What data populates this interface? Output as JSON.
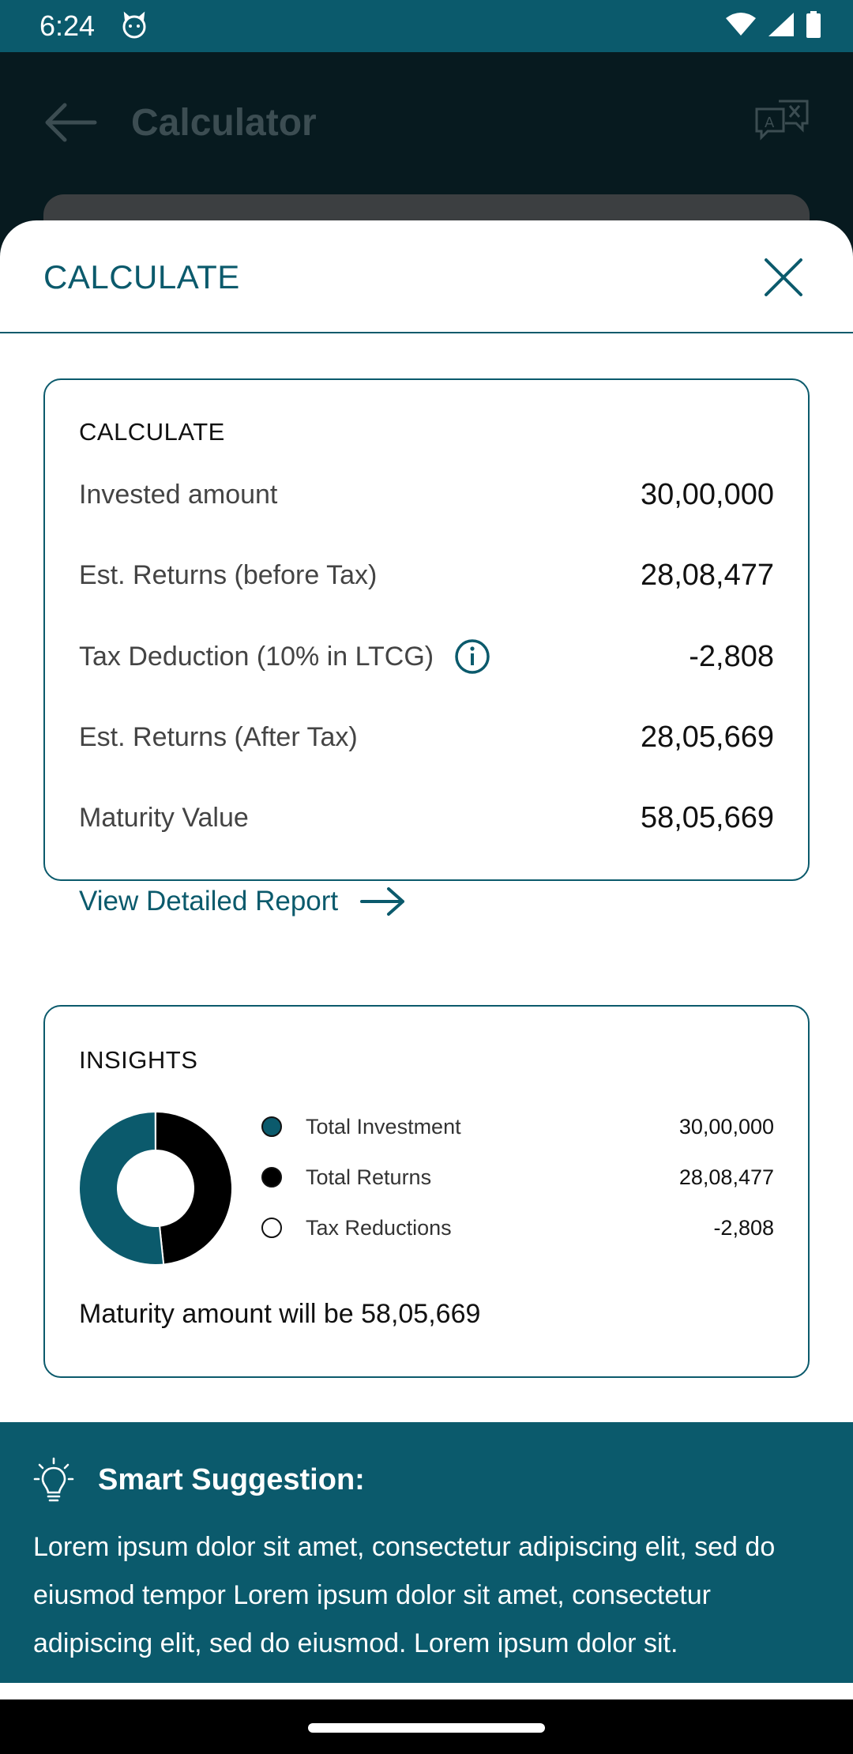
{
  "status_bar": {
    "time": "6:24",
    "icons": [
      "cat-icon",
      "wifi-icon",
      "signal-icon",
      "battery-icon"
    ]
  },
  "app_bar": {
    "title": "Calculator",
    "back_icon": "arrow-left-icon",
    "action_icon": "translate-icon"
  },
  "sheet": {
    "title": "CALCULATE",
    "close_icon": "close-icon"
  },
  "calculate_card": {
    "heading": "CALCULATE",
    "rows": [
      {
        "label": "Invested amount",
        "value": "30,00,000"
      },
      {
        "label": "Est. Returns (before Tax)",
        "value": "28,08,477"
      },
      {
        "label": "Tax Deduction (10% in LTCG)",
        "value": "-2,808"
      },
      {
        "label": "Est. Returns (After Tax)",
        "value": "28,05,669"
      },
      {
        "label": "Maturity Value",
        "value": "58,05,669"
      }
    ],
    "report_link": "View Detailed Report"
  },
  "insights_card": {
    "heading": "INSIGHTS",
    "legend": [
      {
        "label": "Total Investment",
        "value": "30,00,000",
        "color": "#0b5a6c"
      },
      {
        "label": "Total Returns",
        "value": "28,08,477",
        "color": "#000000"
      },
      {
        "label": "Tax Reductions",
        "value": "-2,808",
        "color": "#ffffff"
      }
    ],
    "maturity_text": "Maturity amount will be 58,05,669"
  },
  "chart_data": {
    "type": "pie",
    "categories": [
      "Total Investment",
      "Total Returns",
      "Tax Reductions"
    ],
    "values": [
      3000000,
      2808477,
      2808
    ],
    "colors": [
      "#0b5a6c",
      "#000000",
      "#ffffff"
    ]
  },
  "smart_suggestion": {
    "title": "Smart Suggestion:",
    "text": "Lorem ipsum dolor sit amet, consectetur adipiscing elit, sed do eiusmod tempor Lorem ipsum dolor sit amet, consectetur adipiscing elit, sed do eiusmod.  Lorem ipsum dolor sit."
  },
  "colors": {
    "primary": "#0b5a6c",
    "overlay": "#071a1f"
  }
}
